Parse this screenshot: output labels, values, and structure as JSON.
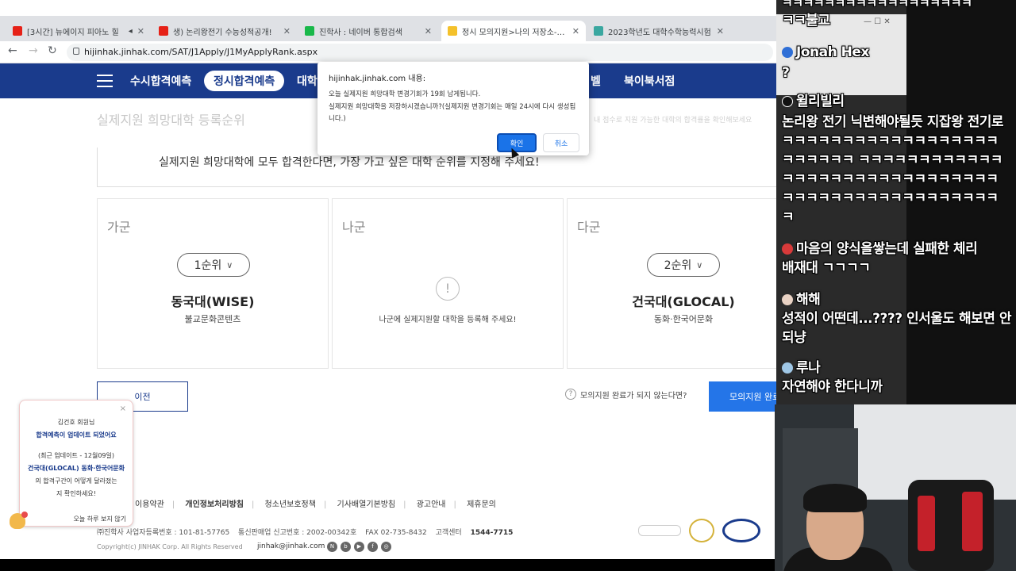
{
  "browser": {
    "tabs": [
      {
        "title": "[3시간] 뉴에이지 피아노 힐",
        "fav_color": "#e62117"
      },
      {
        "title": "생) 논리왕전기 수능성적공개!",
        "fav_color": "#e62117"
      },
      {
        "title": "진학사 : 네이버 통합검색",
        "fav_color": "#19b84a"
      },
      {
        "title": "정시 모의지원>나의 저장소-합격",
        "fav_color": "#f4c12b"
      },
      {
        "title": "2023학년도 대학수학능력시험",
        "fav_color": "#3aa7a0"
      }
    ],
    "url": "hijinhak.jinhak.com/SAT/J1Apply/J1MyApplyRank.aspx"
  },
  "site_nav": {
    "items": [
      "수시합격예측",
      "정시합격예측",
      "대학",
      "벨",
      "북이북서점"
    ]
  },
  "page": {
    "title": "실제지원 희망대학 등록순위",
    "title_note": "내 점수로 지원 가능한 대학의 합격률을 확인해보세요",
    "notice": "실제지원 희망대학에 모두 합격한다면, 가장 가고 싶은 대학 순위를 지정해 주세요!",
    "groups": [
      {
        "label": "가군",
        "rank": "1순위",
        "university": "동국대(WISE)",
        "department": "불교문화콘텐츠"
      },
      {
        "label": "나군",
        "empty_icon": "!",
        "empty_text": "나군에 실제지원할 대학을 등록해 주세요!"
      },
      {
        "label": "다군",
        "rank": "2순위",
        "university": "건국대(GLOCAL)",
        "department": "동화·한국어문화"
      }
    ],
    "prev_label": "이전",
    "help_icon": "?",
    "help_text": "모의지원 완료가 되지 않는다면?",
    "complete_label": "모의지원 완료"
  },
  "footer": {
    "links": [
      "이용약관",
      "개인정보처리방침",
      "청소년보호정책",
      "기사배열기본방침",
      "광고안내",
      "제휴문의"
    ],
    "business_no": "㈜진학사 사업자등록번호 : 101-81-57765",
    "mail_order": "통신판매업 신고번호 : 2002-00342호",
    "fax": "FAX  02-735-8432",
    "center_label": "고객센터",
    "center_phone": "1544-7715",
    "copyright": "Copyright(c) JINHAK Corp. All Rights Reserved",
    "email": "jinhak@jinhak.com",
    "social": [
      "N",
      "b",
      "▶",
      "f",
      "◎"
    ]
  },
  "promo": {
    "close": "×",
    "line1": "김건호 회원님",
    "line2": "합격예측이 업데이트 되었어요",
    "line3": "(최근 업데이트 - 12월09일)",
    "line4": "건국대(GLOCAL) 동화·한국어문화",
    "line5": "의 합격구간이 어떻게 달라졌는",
    "line6": "지 확인하세요!",
    "dismiss": "오늘 하루 보지 않기"
  },
  "dialog": {
    "origin": "hijinhak.jinhak.com 내용:",
    "msg1": "오늘 실제지원 희망대학 변경기회가 19회 남게됩니다.",
    "msg2": "실제지원 희망대학을 저장하시겠습니까?(실제지원 변경기회는 매일 24시에 다시 생성됩니다.)",
    "ok": "확인",
    "cancel": "취소"
  },
  "chat": {
    "window_controls": "—   ☐   ✕",
    "messages": [
      {
        "text": "ㅋㅋㅋㅋㅋㅋㅋㅋㅋㅋㅋㅋㅋㅋㅋㅋㅋㅋ"
      },
      {
        "text": "ㅋㅋ불교"
      },
      {
        "user": "Jonah Hex",
        "badge_color": "#2f6fd6"
      },
      {
        "text": "?"
      },
      {
        "user": "윌리빌리",
        "badge_color": "#111111"
      },
      {
        "text": "논리왕 전기 닉변해야될듯 지잡왕 전기로 ㅋㅋㅋㅋㅋㅋㅋㅋㅋㅋㅋㅋㅋㅋㅋㅋㅋㅋㅋㅋㅋㅋㅋㅋ ㅋㅋㅋㅋㅋㅋㅋㅋㅋㅋㅋㅋㅋㅋㅋㅋㅋㅋㅋㅋㅋㅋㅋㅋㅋㅋㅋㅋㅋㅋㅋㅋㅋㅋㅋㅋㅋㅋㅋㅋㅋㅋㅋㅋㅋㅋㅋㅋㅋ"
      },
      {
        "user": "마음의 양식을쌓는데 실패한 체리",
        "badge_color": "#d83a3a",
        "text": "배재대 ㄱㄱㄱㄱ"
      },
      {
        "user": "해해",
        "badge_color": "#e9d2c4",
        "text": "성적이 어떤데...???? 인서울도 해보면 안되냥"
      },
      {
        "user": "루나",
        "badge_color": "#9fc7e6",
        "text": "자연해야 한다니까"
      }
    ]
  }
}
